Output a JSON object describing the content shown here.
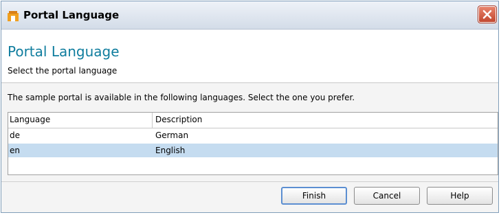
{
  "window": {
    "title": "Portal Language"
  },
  "header": {
    "title": "Portal Language",
    "subtitle": "Select the portal language"
  },
  "intro_text": "The sample portal is available in the following languages. Select the one you prefer.",
  "table": {
    "columns": [
      "Language",
      "Description"
    ],
    "rows": [
      {
        "language": "de",
        "description": "German",
        "selected": false
      },
      {
        "language": "en",
        "description": "English",
        "selected": true
      }
    ]
  },
  "buttons": {
    "finish": "Finish",
    "cancel": "Cancel",
    "help": "Help"
  },
  "icons": {
    "app": "portal-app-icon",
    "close": "close-icon"
  },
  "colors": {
    "title_accent": "#0f7d9e",
    "selected_row": "#c5dcf0",
    "close_button": "#c24830"
  }
}
